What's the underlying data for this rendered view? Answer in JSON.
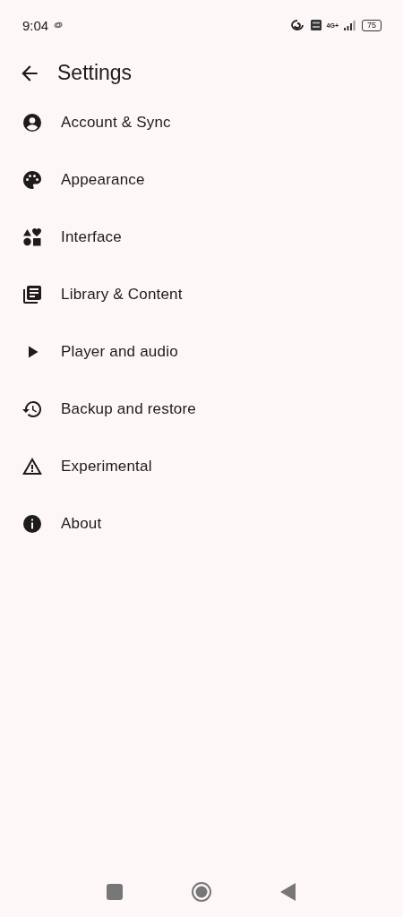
{
  "status_bar": {
    "time": "9:04",
    "network": "4G+",
    "battery": "75"
  },
  "app_bar": {
    "title": "Settings"
  },
  "items": [
    {
      "label": "Account & Sync",
      "kind": "account"
    },
    {
      "label": "Appearance",
      "kind": "palette"
    },
    {
      "label": "Interface",
      "kind": "shapes"
    },
    {
      "label": "Library & Content",
      "kind": "library"
    },
    {
      "label": "Player and audio",
      "kind": "play"
    },
    {
      "label": "Backup and restore",
      "kind": "history"
    },
    {
      "label": "Experimental",
      "kind": "warning"
    },
    {
      "label": "About",
      "kind": "info"
    }
  ]
}
